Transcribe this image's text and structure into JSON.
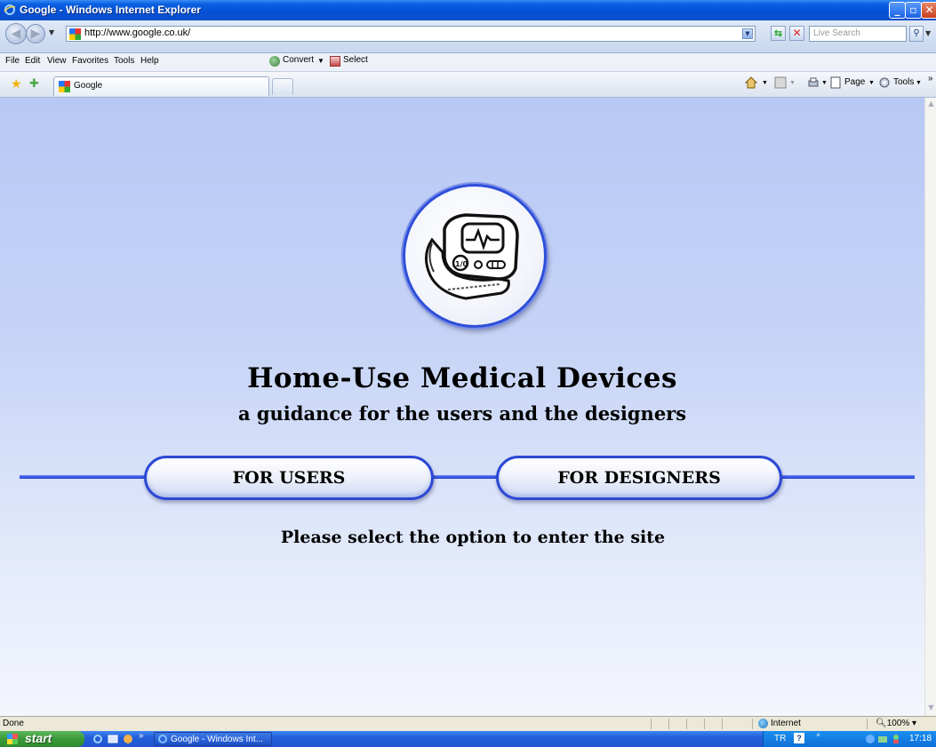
{
  "window": {
    "title": "Google - Windows Internet Explorer",
    "minimize_glyph": "_",
    "maximize_glyph": "▫",
    "close_glyph": "✕"
  },
  "address_bar": {
    "url": "http://www.google.co.uk/",
    "search_placeholder": "Live Search"
  },
  "menu": {
    "items": [
      "File",
      "Edit",
      "View",
      "Favorites",
      "Tools",
      "Help"
    ],
    "convert_label": "Convert",
    "select_label": "Select"
  },
  "tabs": {
    "active_tab_label": "Google",
    "page_menu_label": "Page",
    "tools_menu_label": "Tools"
  },
  "page": {
    "headline": "Home-Use Medical Devices",
    "subheadline": "a guidance for the users and the designers",
    "users_button": "FOR USERS",
    "designers_button": "FOR DESIGNERS",
    "prompt": "Please select the option to enter the site",
    "device_screen_digits": "1/0"
  },
  "status_bar": {
    "status": "Done",
    "zone": "Internet",
    "zoom": "100%"
  },
  "taskbar": {
    "start_label": "start",
    "task_item": "Google - Windows Int...",
    "language": "TR",
    "clock": "17:18"
  },
  "colors": {
    "accent_blue": "#2c48d4",
    "content_bg_top": "#b7c8f5",
    "content_bg_bottom": "#f4f6fd"
  }
}
